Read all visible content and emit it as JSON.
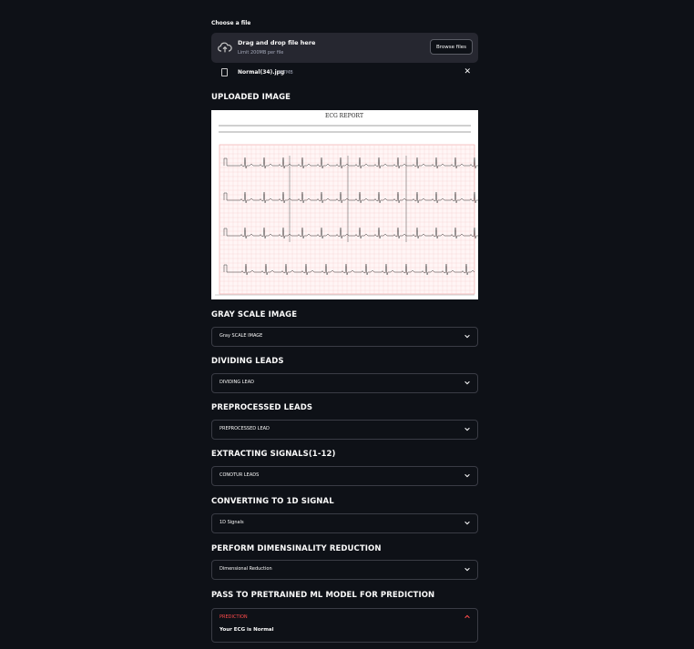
{
  "uploader": {
    "label": "Choose a file",
    "drag_text": "Drag and drop file here",
    "limit_text": "Limit 200MB per file",
    "browse_label": "Browse files",
    "file_name": "Normal(34).jpg",
    "file_size": "0.7MB"
  },
  "sections": {
    "uploaded": {
      "heading": "UPLOADED IMAGE"
    },
    "gray": {
      "heading": "GRAY SCALE IMAGE",
      "expander": "Gray SCALE IMAGE"
    },
    "dividing": {
      "heading": "DIVIDING LEADS",
      "expander": "DIVIDING LEAD"
    },
    "preprocessed": {
      "heading": "PREPROCESSED LEADS",
      "expander": "PREPROCESSED LEAD"
    },
    "extracting": {
      "heading": "EXTRACTING SIGNALS(1-12)",
      "expander": "CONOTUR LEADS"
    },
    "converting": {
      "heading": "CONVERTING TO 1D SIGNAL",
      "expander": "1D Signals"
    },
    "reduction": {
      "heading": "PERFORM DIMENSINALITY REDUCTION",
      "expander": "Dimensional Reduction"
    },
    "prediction": {
      "heading": "PASS TO PRETRAINED ML MODEL FOR PREDICTION",
      "expander": "PREDICTION",
      "result": "Your ECG is Normal"
    }
  },
  "ecg": {
    "title": "ECG REPORT"
  },
  "colors": {
    "background": "#0e1117",
    "surface": "#262730",
    "accent": "#ff4b4b",
    "border": "#3a3c45"
  },
  "icons": {
    "upload": "cloud-upload-icon",
    "file": "file-icon",
    "remove": "close-icon",
    "collapse": "chevron-down-icon",
    "expand": "chevron-up-icon"
  }
}
